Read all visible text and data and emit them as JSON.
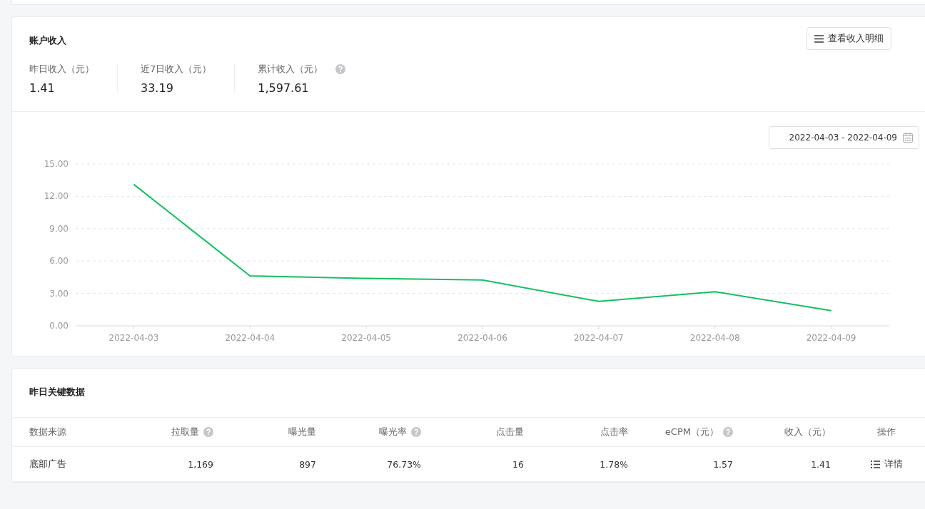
{
  "income_card": {
    "title": "账户收入",
    "detail_button": {
      "label": "查看收入明细"
    },
    "stats": [
      {
        "label": "昨日收入（元）",
        "value": "1.41",
        "help": false
      },
      {
        "label": "近7日收入（元）",
        "value": "33.19",
        "help": false
      },
      {
        "label": "累计收入（元）",
        "value": "1,597.61",
        "help": true
      }
    ],
    "date_range": {
      "value": "2022-04-03 - 2022-04-09"
    },
    "chart_data": {
      "type": "line",
      "categories": [
        "2022-04-03",
        "2022-04-04",
        "2022-04-05",
        "2022-04-06",
        "2022-04-07",
        "2022-04-08",
        "2022-04-09"
      ],
      "grid": true,
      "series": [
        {
          "color": "#13c160",
          "values": [
            13.11,
            4.62,
            4.39,
            4.24,
            2.26,
            3.16,
            1.41
          ]
        }
      ],
      "ylim": [
        0,
        15
      ],
      "yticks": [
        {
          "value": 0,
          "label": "0.00"
        },
        {
          "value": 3,
          "label": "3.00"
        },
        {
          "value": 6,
          "label": "6.00"
        },
        {
          "value": 9,
          "label": "9.00"
        },
        {
          "value": 12,
          "label": "12.00"
        },
        {
          "value": 15,
          "label": "15.00"
        }
      ]
    }
  },
  "key_data_card": {
    "title": "昨日关键数据",
    "table": {
      "columns": [
        {
          "label": "数据来源",
          "help": false
        },
        {
          "label": "拉取量",
          "help": true
        },
        {
          "label": "曝光量",
          "help": false
        },
        {
          "label": "曝光率",
          "help": true
        },
        {
          "label": "点击量",
          "help": false
        },
        {
          "label": "点击率",
          "help": false
        },
        {
          "label": "eCPM（元）",
          "help": true
        },
        {
          "label": "收入（元）",
          "help": false
        },
        {
          "label": "操作",
          "help": false
        }
      ],
      "rows": [
        {
          "cells": [
            "底部广告",
            "1,169",
            "897",
            "76.73%",
            "16",
            "1.78%",
            "1.57",
            "1.41"
          ],
          "action": "详情"
        }
      ]
    }
  }
}
